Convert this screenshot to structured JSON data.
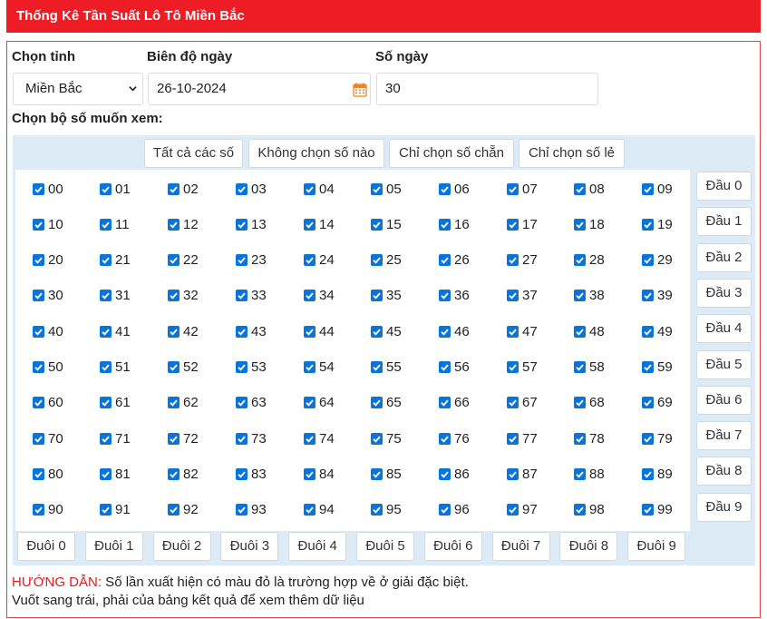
{
  "header": {
    "title": "Thống Kê Tần Suất Lô Tô Miền Bắc"
  },
  "form": {
    "province_label": "Chọn tỉnh",
    "province_value": "Miền Bắc",
    "date_label": "Biên độ ngày",
    "date_value": "26-10-2024",
    "days_label": "Số ngày",
    "days_value": "30",
    "pick_label": "Chọn bộ số muốn xem:"
  },
  "quick_buttons": [
    "Tất cả các số",
    "Không chọn số nào",
    "Chỉ chọn số chẵn",
    "Chỉ chọn số lẻ"
  ],
  "numbers": {
    "all_checked": true,
    "rows": [
      [
        "00",
        "01",
        "02",
        "03",
        "04",
        "05",
        "06",
        "07",
        "08",
        "09"
      ],
      [
        "10",
        "11",
        "12",
        "13",
        "14",
        "15",
        "16",
        "17",
        "18",
        "19"
      ],
      [
        "20",
        "21",
        "22",
        "23",
        "24",
        "25",
        "26",
        "27",
        "28",
        "29"
      ],
      [
        "30",
        "31",
        "32",
        "33",
        "34",
        "35",
        "36",
        "37",
        "38",
        "39"
      ],
      [
        "40",
        "41",
        "42",
        "43",
        "44",
        "45",
        "46",
        "47",
        "48",
        "49"
      ],
      [
        "50",
        "51",
        "52",
        "53",
        "54",
        "55",
        "56",
        "57",
        "58",
        "59"
      ],
      [
        "60",
        "61",
        "62",
        "63",
        "64",
        "65",
        "66",
        "67",
        "68",
        "69"
      ],
      [
        "70",
        "71",
        "72",
        "73",
        "74",
        "75",
        "76",
        "77",
        "78",
        "79"
      ],
      [
        "80",
        "81",
        "82",
        "83",
        "84",
        "85",
        "86",
        "87",
        "88",
        "89"
      ],
      [
        "90",
        "91",
        "92",
        "93",
        "94",
        "95",
        "96",
        "97",
        "98",
        "99"
      ]
    ]
  },
  "dau_buttons": [
    "Đầu 0",
    "Đầu 1",
    "Đầu 2",
    "Đầu 3",
    "Đầu 4",
    "Đầu 5",
    "Đầu 6",
    "Đầu 7",
    "Đầu 8",
    "Đầu 9"
  ],
  "duoi_buttons": [
    "Đuôi 0",
    "Đuôi 1",
    "Đuôi 2",
    "Đuôi 3",
    "Đuôi 4",
    "Đuôi 5",
    "Đuôi 6",
    "Đuôi 7",
    "Đuôi 8",
    "Đuôi 9"
  ],
  "guide": {
    "prefix": "HƯỚNG DẪN:",
    "line1": " Số lần xuất hiện có màu đỏ là trường hợp về ở giải đặc biệt.",
    "line2": "Vuốt sang trái, phải của bảng kết quả để xem thêm dữ liệu"
  },
  "colors": {
    "header_bg": "#ee1c25",
    "checkbox": "#0a74da",
    "grid_bg": "#dcebf5",
    "guide_red": "#e21d1d"
  }
}
